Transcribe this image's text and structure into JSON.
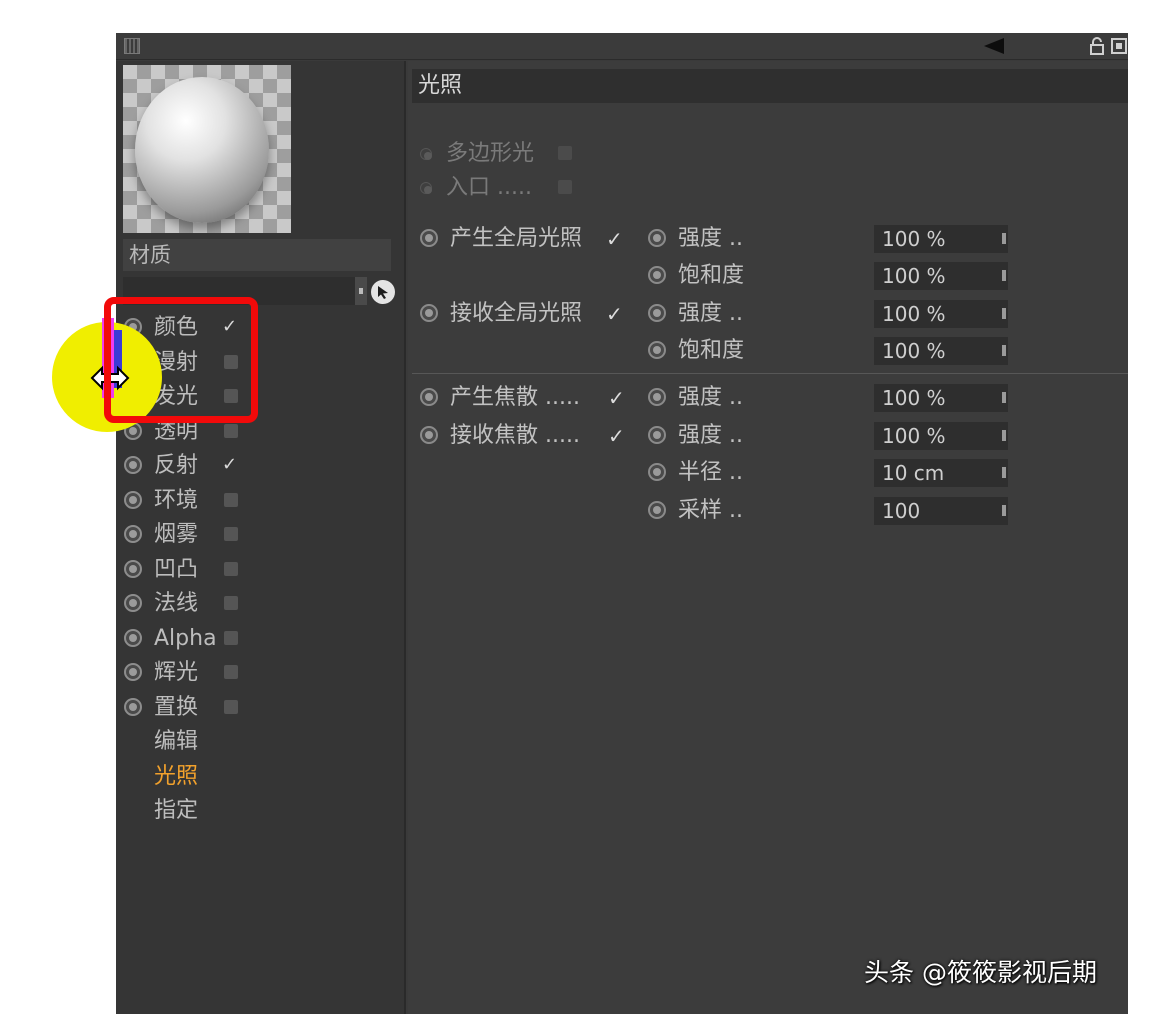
{
  "material": {
    "name_label": "材质"
  },
  "channels": [
    {
      "label": "颜色",
      "checked": true
    },
    {
      "label": "漫射",
      "checked": false
    },
    {
      "label": "发光",
      "checked": false
    },
    {
      "label": "透明",
      "checked": false
    },
    {
      "label": "反射",
      "checked": true
    },
    {
      "label": "环境",
      "checked": false
    },
    {
      "label": "烟雾",
      "checked": false
    },
    {
      "label": "凹凸",
      "checked": false
    },
    {
      "label": "法线",
      "checked": false
    },
    {
      "label": "Alpha",
      "checked": false
    },
    {
      "label": "辉光",
      "checked": false
    },
    {
      "label": "置换",
      "checked": false
    }
  ],
  "nav": {
    "edit": "编辑",
    "illumination": "光照",
    "assign": "指定"
  },
  "section": {
    "title": "光照"
  },
  "options": {
    "polygon_light": "多边形光",
    "portal": "入口 .....",
    "generate_gi": "产生全局光照",
    "receive_gi": "接收全局光照",
    "generate_caustics": "产生焦散 .....",
    "receive_caustics": "接收焦散 .....",
    "check_mark": "✓"
  },
  "params": {
    "strength_label": "强度 ..",
    "saturation_label": "饱和度",
    "radius_label": "半径 ..",
    "samples_label": "采样 ..",
    "gen_gi_strength": "100 %",
    "gen_gi_saturation": "100 %",
    "rec_gi_strength": "100 %",
    "rec_gi_saturation": "100 %",
    "gen_caustics_strength": "100 %",
    "rec_caustics_strength": "100 %",
    "rec_caustics_radius": "10 cm",
    "rec_caustics_samples": "100"
  },
  "watermark": {
    "text": "头条 @筱筱影视后期"
  },
  "colors": {
    "active_nav": "#f2a12c",
    "annotation": "#f20a0a",
    "cursor_highlight": "#f0ee00"
  }
}
